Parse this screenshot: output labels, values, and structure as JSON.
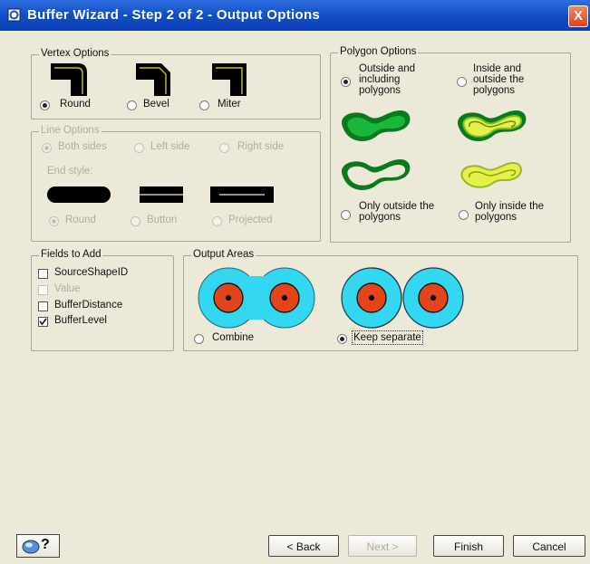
{
  "window": {
    "title": "Buffer Wizard - Step 2 of 2 - Output Options",
    "close_glyph": "X"
  },
  "vertex_options": {
    "legend": "Vertex Options",
    "options": [
      {
        "label": "Round",
        "selected": true,
        "icon": "round-vertex-icon"
      },
      {
        "label": "Bevel",
        "selected": false,
        "icon": "bevel-vertex-icon"
      },
      {
        "label": "Miter",
        "selected": false,
        "icon": "miter-vertex-icon"
      }
    ]
  },
  "line_options": {
    "legend": "Line Options",
    "sides": [
      {
        "label": "Both sides",
        "selected": true
      },
      {
        "label": "Left side",
        "selected": false
      },
      {
        "label": "Right side",
        "selected": false
      }
    ],
    "end_style_label": "End style:",
    "end_styles": [
      {
        "label": "Round",
        "selected": true
      },
      {
        "label": "Button",
        "selected": false
      },
      {
        "label": "Projected",
        "selected": false
      }
    ]
  },
  "polygon_options": {
    "legend": "Polygon Options",
    "options": [
      {
        "label": "Outside and including polygons",
        "selected": true
      },
      {
        "label": "Inside and outside the polygons",
        "selected": false
      },
      {
        "label": "Only outside the polygons",
        "selected": false
      },
      {
        "label": "Only inside the polygons",
        "selected": false
      }
    ],
    "colors": {
      "dark_green": "#0a7a1e",
      "green": "#19b83c",
      "yellow": "#e6f04a"
    }
  },
  "fields_to_add": {
    "legend": "Fields to Add",
    "fields": [
      {
        "label": "SourceShapeID",
        "checked": false,
        "enabled": true
      },
      {
        "label": "Value",
        "checked": false,
        "enabled": false
      },
      {
        "label": "BufferDistance",
        "checked": false,
        "enabled": true
      },
      {
        "label": "BufferLevel",
        "checked": true,
        "enabled": true
      }
    ]
  },
  "output_areas": {
    "legend": "Output Areas",
    "options": [
      {
        "label": "Combine",
        "selected": false
      },
      {
        "label": "Keep separate",
        "selected": true
      }
    ],
    "colors": {
      "buffer": "#33d7f0",
      "feature": "#e0461a",
      "center": "#000000"
    }
  },
  "footer": {
    "help_icon": "help-question-icon",
    "help_glyph": "?",
    "buttons": [
      {
        "label": "< Back",
        "enabled": true
      },
      {
        "label": "Next >",
        "enabled": false
      },
      {
        "label": "Finish",
        "enabled": true
      },
      {
        "label": "Cancel",
        "enabled": true
      }
    ]
  }
}
